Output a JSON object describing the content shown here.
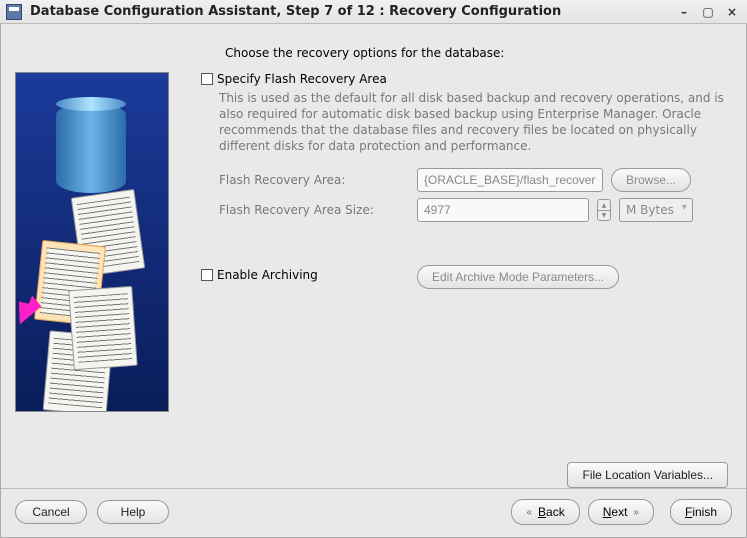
{
  "titlebar": {
    "title": "Database Configuration Assistant, Step 7 of 12 : Recovery Configuration"
  },
  "main": {
    "intro": "Choose the recovery options for the database:",
    "flash": {
      "checkbox_label": "Specify Flash Recovery Area",
      "description": "This is used as the default for all disk based backup and recovery operations, and is also required for automatic disk based backup using Enterprise Manager. Oracle recommends that the database files and recovery files be located on physically different disks for data protection and performance.",
      "area_label": "Flash Recovery Area:",
      "area_value": "{ORACLE_BASE}/flash_recovery_",
      "browse_label": "Browse...",
      "size_label": "Flash Recovery Area Size:",
      "size_value": "4977",
      "size_unit": "M Bytes"
    },
    "archive": {
      "checkbox_label": "Enable Archiving",
      "edit_label": "Edit Archive Mode Parameters..."
    },
    "file_loc_label": "File Location Variables..."
  },
  "footer": {
    "cancel": "Cancel",
    "help": "Help",
    "back": "Back",
    "next": "Next",
    "finish": "Finish"
  }
}
